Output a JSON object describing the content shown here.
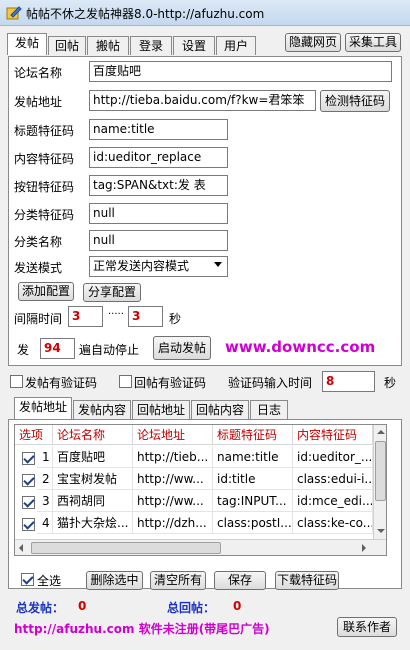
{
  "window": {
    "title": "帖帖不休之发帖神器8.0-http://afuzhu.com"
  },
  "top_tabs": [
    {
      "label": "发帖",
      "active": true
    },
    {
      "label": "回帖"
    },
    {
      "label": "搬帖"
    },
    {
      "label": "登录"
    },
    {
      "label": "设置"
    },
    {
      "label": "用户"
    }
  ],
  "top_buttons": {
    "hide": "隐藏网页",
    "collect": "采集工具"
  },
  "form": {
    "forum_name_label": "论坛名称",
    "forum_name": "百度贴吧",
    "post_url_label": "发帖地址",
    "post_url": "http://tieba.baidu.com/f?kw=君笨笨",
    "detect_btn": "检测特征码",
    "title_code_label": "标题特征码",
    "title_code": "name:title",
    "content_code_label": "内容特征码",
    "content_code": "id:ueditor_replace",
    "button_code_label": "按钮特征码",
    "button_code": "tag:SPAN&txt:发 表",
    "category_code_label": "分类特征码",
    "category_code": "null",
    "category_name_label": "分类名称",
    "category_name": "null",
    "send_mode_label": "发送模式",
    "send_mode": "正常发送内容模式",
    "add_config": "添加配置",
    "share_config": "分享配置",
    "interval_label": "间隔时间",
    "interval_from": "3",
    "interval_sep": "·····",
    "interval_to": "3",
    "interval_unit": "秒",
    "send_label": "发",
    "send_count": "94",
    "send_stop_label": "遍自动停止",
    "auto_post_btn": "启动发帖",
    "watermark": "www.downcc.com"
  },
  "options": {
    "post_captcha": "发帖有验证码",
    "reply_captcha": "回帖有验证码",
    "captcha_time_label": "验证码输入时间",
    "captcha_time": "8",
    "captcha_unit": "秒"
  },
  "bottom_tabs": [
    {
      "label": "发帖地址",
      "active": true
    },
    {
      "label": "发帖内容"
    },
    {
      "label": "回帖地址"
    },
    {
      "label": "回帖内容"
    },
    {
      "label": "日志"
    }
  ],
  "table": {
    "headers": [
      "选项",
      "论坛名称",
      "论坛地址",
      "标题特征码",
      "内容特征码"
    ],
    "rows": [
      {
        "checked": true,
        "num": "1",
        "name": "百度贴吧",
        "url": "http://tieb...",
        "title": "name:title",
        "content": "id:ueditor_..."
      },
      {
        "checked": true,
        "num": "2",
        "name": "宝宝树发帖",
        "url": "http://ww...",
        "title": "id:title",
        "content": "class:edui-i..."
      },
      {
        "checked": true,
        "num": "3",
        "name": "西祠胡同",
        "url": "http://ww...",
        "title": "tag:INPUT...",
        "content": "id:mce_edi..."
      },
      {
        "checked": true,
        "num": "4",
        "name": "猫扑大杂烩...",
        "url": "http://dzh...",
        "title": "class:postI...",
        "content": "class:ke-co..."
      }
    ]
  },
  "bottom_buttons": {
    "select_all": "全选",
    "delete": "删除选中",
    "clear": "清空所有",
    "save": "保存",
    "download": "下载特征码"
  },
  "stats": {
    "total_post_label": "总发帖：",
    "total_post": "0",
    "total_reply_label": "总回帖：",
    "total_reply": "0"
  },
  "footer": {
    "status": "http://afuzhu.com 软件未注册(带尾巴广告)",
    "contact": "联系作者"
  }
}
